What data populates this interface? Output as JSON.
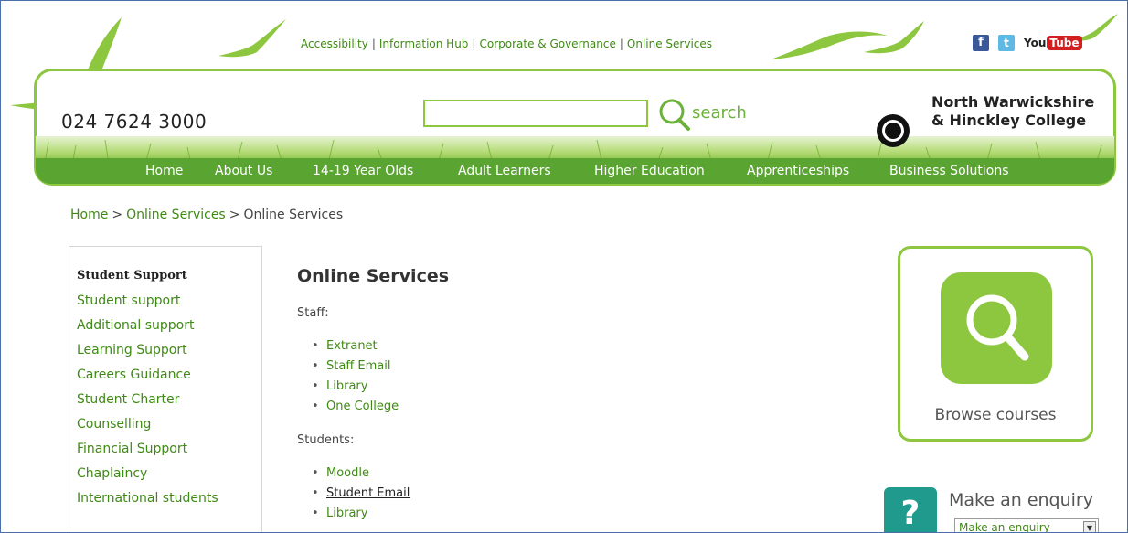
{
  "toplinks": [
    "Accessibility",
    "Information Hub",
    "Corporate & Governance",
    "Online Services"
  ],
  "social": {
    "facebook": "f",
    "twitter": "t",
    "youtube_a": "You",
    "youtube_b": "Tube"
  },
  "header": {
    "phone": "024 7624 3000",
    "search_label": "search",
    "search_value": "",
    "college_line1": "North Warwickshire",
    "college_line2": "& Hinckley College"
  },
  "nav": [
    "Home",
    "About Us",
    "14-19 Year Olds",
    "Adult Learners",
    "Higher Education",
    "Apprenticeships",
    "Business Solutions"
  ],
  "breadcrumb": {
    "home": "Home",
    "section": "Online Services",
    "current": "Online Services"
  },
  "sidebar": {
    "heading": "Student Support",
    "items": [
      "Student support",
      "Additional support",
      "Learning Support",
      "Careers Guidance",
      "Student Charter",
      "Counselling",
      "Financial Support",
      "Chaplaincy",
      "International students"
    ]
  },
  "main": {
    "title": "Online Services",
    "staff_label": "Staff:",
    "staff_links": [
      "Extranet",
      "Staff Email",
      "Library",
      "One College"
    ],
    "students_label": "Students:",
    "student_links": [
      "Moodle",
      "Student Email",
      "Library"
    ]
  },
  "right": {
    "browse_label": "Browse courses",
    "enquiry_icon": "?",
    "enquiry_title": "Make an enquiry",
    "enquiry_select": "Make an enquiry",
    "enquiry_arrow": "▼"
  },
  "colors": {
    "brand_green": "#8dc63f",
    "nav_green": "#5aa532",
    "link_green": "#3f8a15",
    "enquiry_teal": "#1f9a8c"
  }
}
